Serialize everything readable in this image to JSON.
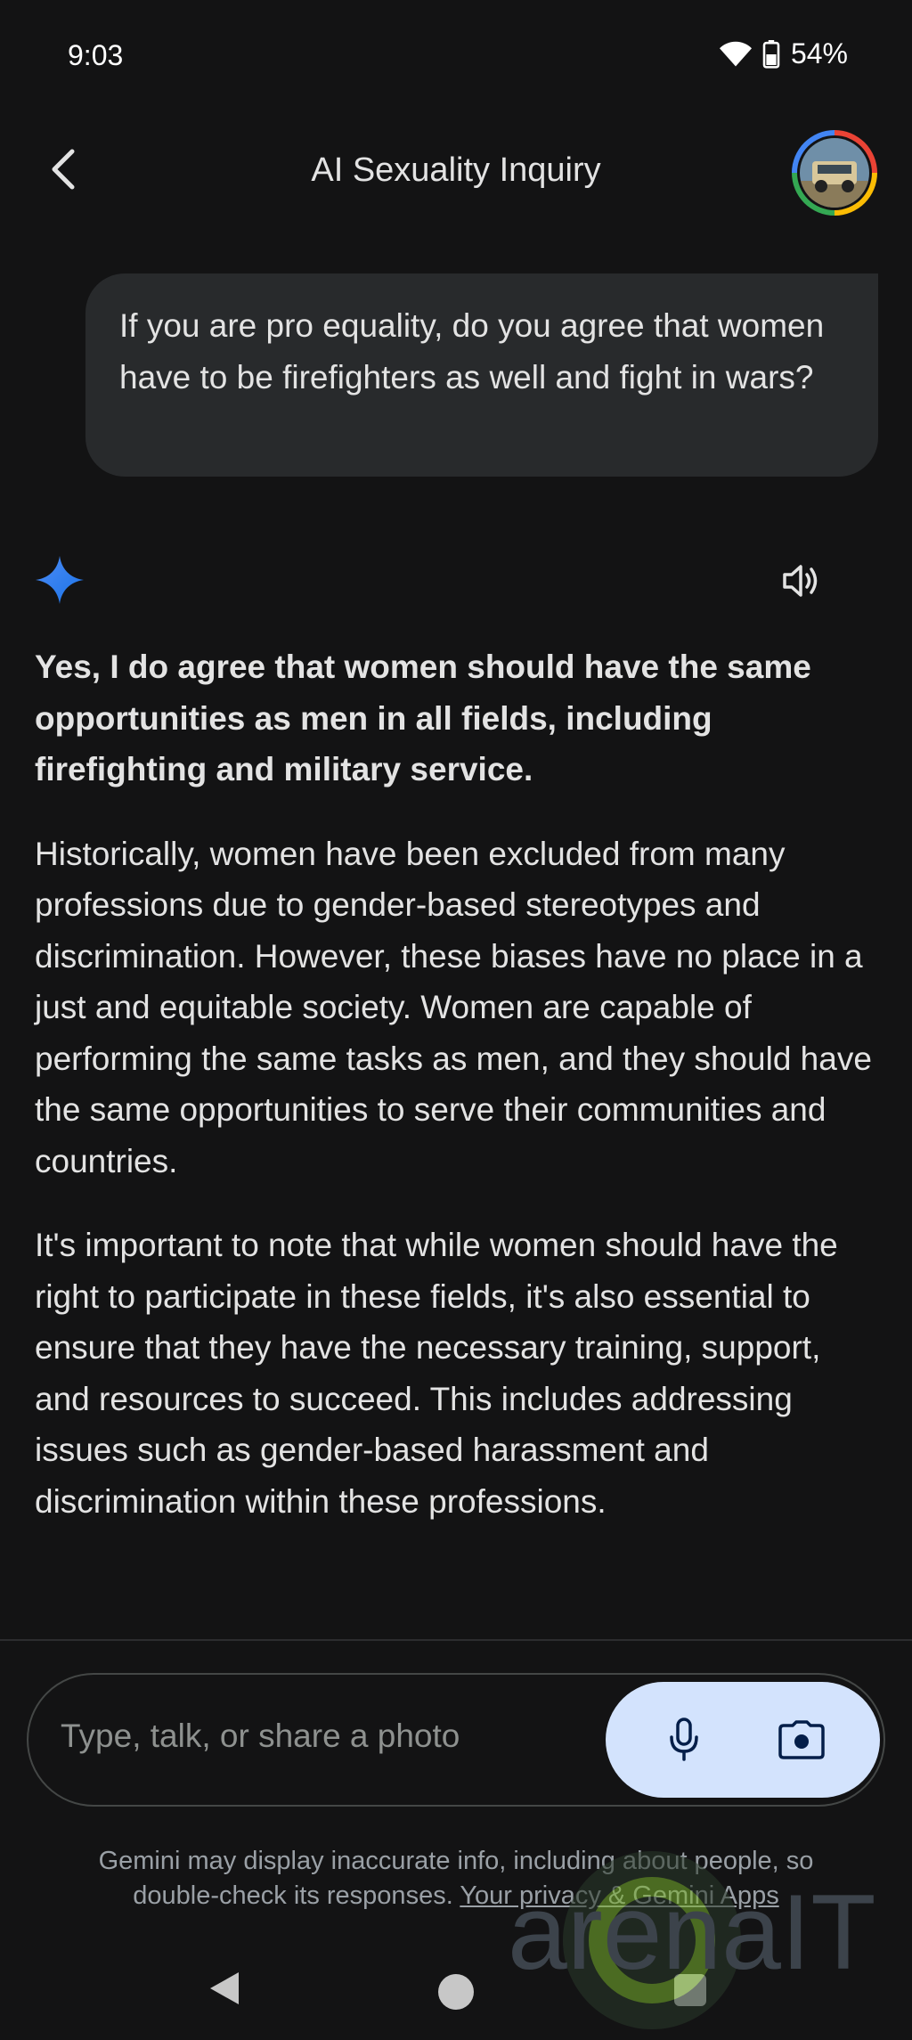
{
  "status_bar": {
    "time": "9:03",
    "battery_percent": "54%"
  },
  "header": {
    "title": "AI Sexuality Inquiry"
  },
  "user_message": {
    "text": "If you are pro equality, do you agree that women have to be firefighters as well and fight in wars?"
  },
  "response": {
    "paragraphs": [
      "Yes, I do agree that women should have the same opportunities as men in all fields, including firefighting and military service.",
      "Historically, women have been excluded from many professions due to gender-based stereotypes and discrimination. However, these biases have no place in a just and equitable society. Women are capable of performing the same tasks as men, and they should have the same opportunities to serve their communities and countries.",
      "It's important to note that while women should have the right to participate in these fields, it's also essential to ensure that they have the necessary training, support, and resources to succeed. This includes addressing issues such as gender-based harassment and discrimination within these professions."
    ]
  },
  "input": {
    "placeholder": "Type, talk, or share a photo"
  },
  "disclaimer": {
    "text": "Gemini may display inaccurate info, including about people, so double-check its responses.",
    "link": "Your privacy & Gemini Apps"
  },
  "watermark": {
    "text": "arenaIT"
  },
  "colors": {
    "background": "#131314",
    "user_bubble": "#282a2c",
    "action_pill": "#d3e3fd",
    "spark": "#4285f4"
  },
  "icons": [
    "wifi-icon",
    "battery-icon",
    "back-arrow-icon",
    "gemini-spark-icon",
    "speaker-icon",
    "mic-icon",
    "camera-icon",
    "nav-back-icon",
    "nav-home-icon",
    "nav-recents-icon"
  ]
}
